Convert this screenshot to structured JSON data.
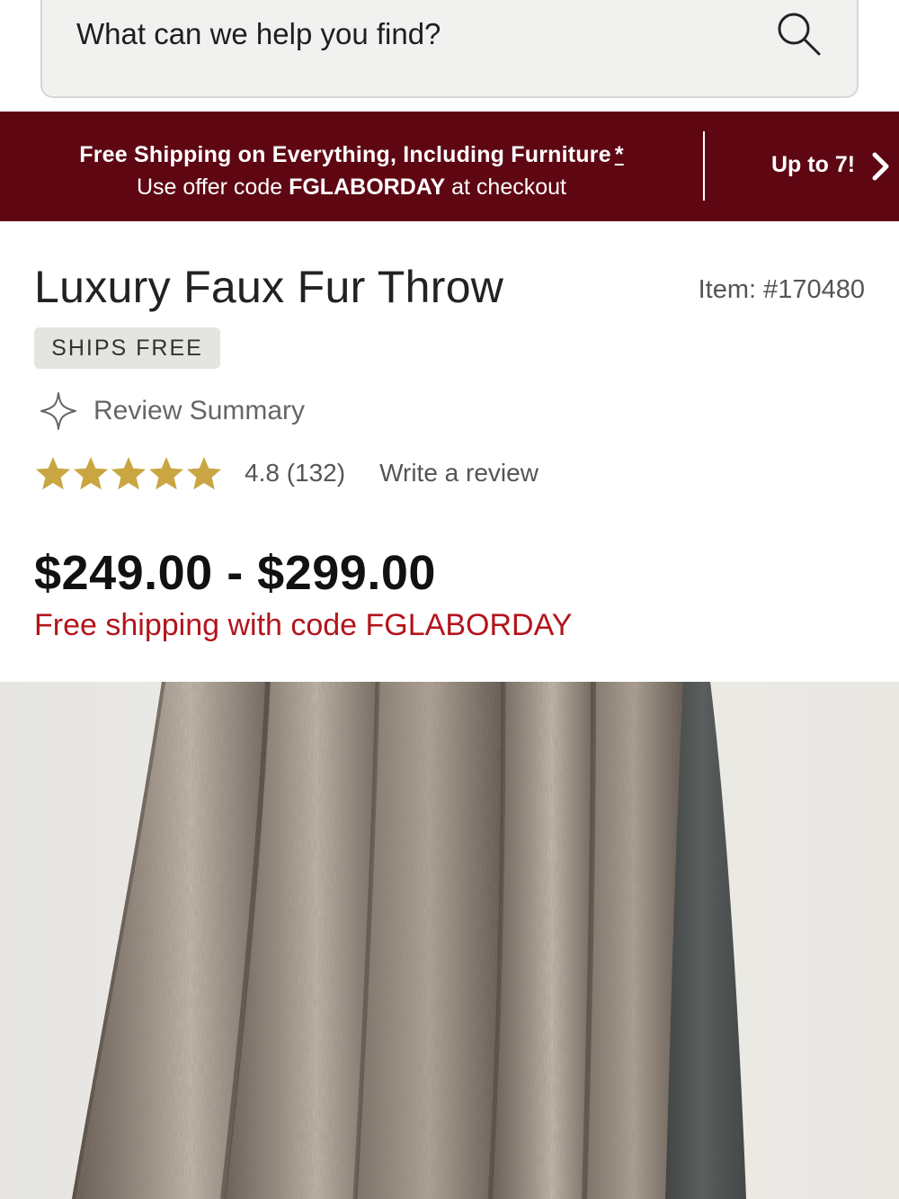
{
  "search": {
    "placeholder": "What can we help you find?"
  },
  "promo": {
    "line1": "Free Shipping on Everything, Including Furniture",
    "asterisk": "*",
    "line2_prefix": "Use offer code",
    "line2_code": "FGLABORDAY",
    "line2_suffix": "at checkout",
    "next_promo": "Up to 7!"
  },
  "product": {
    "title": "Luxury Faux Fur Throw",
    "item_number": "Item: #170480",
    "badge": "SHIPS FREE",
    "review_summary_label": "Review Summary",
    "rating_text": "4.8 (132)",
    "rating": 4.8,
    "write_review": "Write a review",
    "price": "$249.00 - $299.00",
    "free_shipping": "Free shipping with code FGLABORDAY"
  },
  "colors": {
    "promo_bg": "#5e0713",
    "star": "#c9a641",
    "free_shipping_text": "#b3141c"
  },
  "icons": {
    "search": "search-icon",
    "chevron": "chevron-right-icon",
    "sparkle": "sparkle-icon",
    "star": "star-icon"
  }
}
